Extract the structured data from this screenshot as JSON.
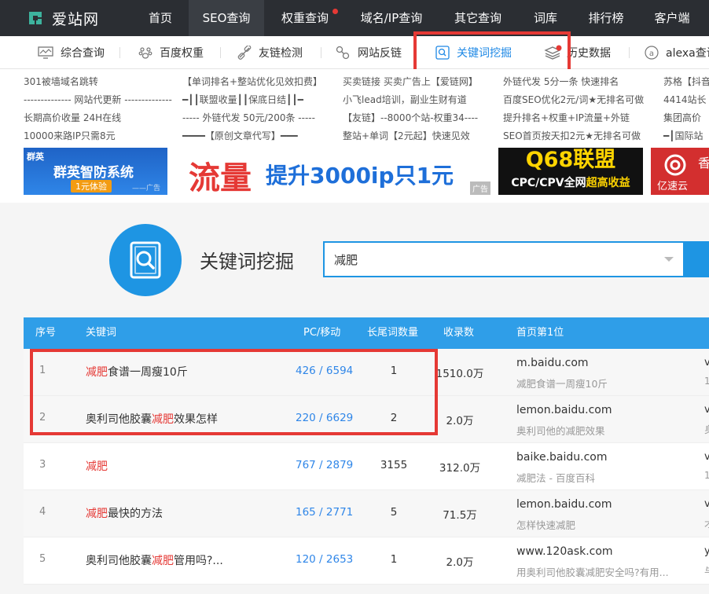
{
  "logo": {
    "text": "爱站网"
  },
  "nav": [
    {
      "label": "首页"
    },
    {
      "label": "SEO查询"
    },
    {
      "label": "权重查询"
    },
    {
      "label": "域名/IP查询"
    },
    {
      "label": "其它查询"
    },
    {
      "label": "词库"
    },
    {
      "label": "排行榜"
    },
    {
      "label": "客户端"
    }
  ],
  "subnav": [
    {
      "label": "综合查询",
      "icon": "monitor-icon"
    },
    {
      "label": "百度权重",
      "icon": "paw-icon"
    },
    {
      "label": "友链检测",
      "icon": "link-icon"
    },
    {
      "label": "网站反链",
      "icon": "chain-icon"
    },
    {
      "label": "关键词挖掘",
      "icon": "search-box-icon"
    },
    {
      "label": "历史数据",
      "icon": "layers-icon"
    },
    {
      "label": "alexa查询",
      "icon": "alexa-icon"
    }
  ],
  "adlinks": [
    [
      "301被墙域名跳转",
      "-------------- 网站代更新 --------------",
      "长期高价收量 24H在线",
      "10000来路IP只需8元"
    ],
    [
      "【单词排名+整站优化见效扣费】",
      "━┃┃联盟收量┃┃保底日结┃┃━",
      "----- 外链代发 50元/200条 -----",
      "━━━━【原创文章代写】━━━"
    ],
    [
      "买卖链接 买卖广告上【爱链网】",
      "小飞lead培训，副业生财有道",
      "【友链】--8000个站-权重34----",
      "整站+单词【2元起】快速见效"
    ],
    [
      "外链代发 5分一条 快速排名",
      "百度SEO优化2元/词★无排名可做",
      "提升排名+权重+IP流量+外链",
      "SEO首页按天扣2元★无排名可做"
    ],
    [
      "苏格【抖音",
      "4414站长",
      "集团高价",
      "━┃国际站"
    ]
  ],
  "banners": {
    "b1_brand": "群英",
    "b1_title": "群英智防系统",
    "b1_sub": "1元体验",
    "b1_ad": "——广告",
    "b2_big": "流量",
    "b2_text": "提升3000ip只1元",
    "b2_ad": "广告",
    "b3_title": "Q68联盟",
    "b3_sub_prefix": "CPC/CPV全网",
    "b3_sub_hl": "超高收益",
    "b4_text": "亿速云",
    "b4_char": "香"
  },
  "search": {
    "title": "关键词挖掘",
    "value": "减肥"
  },
  "table": {
    "headers": [
      "序号",
      "关键词",
      "PC/移动",
      "长尾词数量",
      "收录数",
      "首页第1位"
    ],
    "rows": [
      {
        "idx": "1",
        "kw_pre": "",
        "kw_hl": "减肥",
        "kw_post": "食谱一周瘦10斤",
        "pc": "426 / 6594",
        "long": "1",
        "inc": "1510.0万",
        "domain": "m.baidu.com",
        "desc": "减肥食谱一周瘦10斤",
        "edge": "v",
        "edge2": "1"
      },
      {
        "idx": "2",
        "kw_pre": "奥利司他胶囊",
        "kw_hl": "减肥",
        "kw_post": "效果怎样",
        "pc": "220 / 6629",
        "long": "2",
        "inc": "2.0万",
        "domain": "lemon.baidu.com",
        "desc": "奥利司他的减肥效果",
        "edge": "v",
        "edge2": "身"
      },
      {
        "idx": "3",
        "kw_pre": "",
        "kw_hl": "减肥",
        "kw_post": "",
        "pc": "767 / 2879",
        "long": "3155",
        "inc": "312.0万",
        "domain": "baike.baidu.com",
        "desc": "减肥法 - 百度百科",
        "edge": "v",
        "edge2": "1"
      },
      {
        "idx": "4",
        "kw_pre": "",
        "kw_hl": "减肥",
        "kw_post": "最快的方法",
        "pc": "165 / 2771",
        "long": "5",
        "inc": "71.5万",
        "domain": "lemon.baidu.com",
        "desc": "怎样快速减肥",
        "edge": "v",
        "edge2": "才"
      },
      {
        "idx": "5",
        "kw_pre": "奥利司他胶囊",
        "kw_hl": "减肥",
        "kw_post": "管用吗?...",
        "pc": "120 / 2653",
        "long": "1",
        "inc": "2.0万",
        "domain": "www.120ask.com",
        "desc": "用奥利司他胶囊减肥安全吗?有用...",
        "edge": "y",
        "edge2": "与"
      }
    ]
  },
  "colors": {
    "accent": "#1e95e3",
    "highlight": "#e53935",
    "topbar": "#2b2e33"
  }
}
